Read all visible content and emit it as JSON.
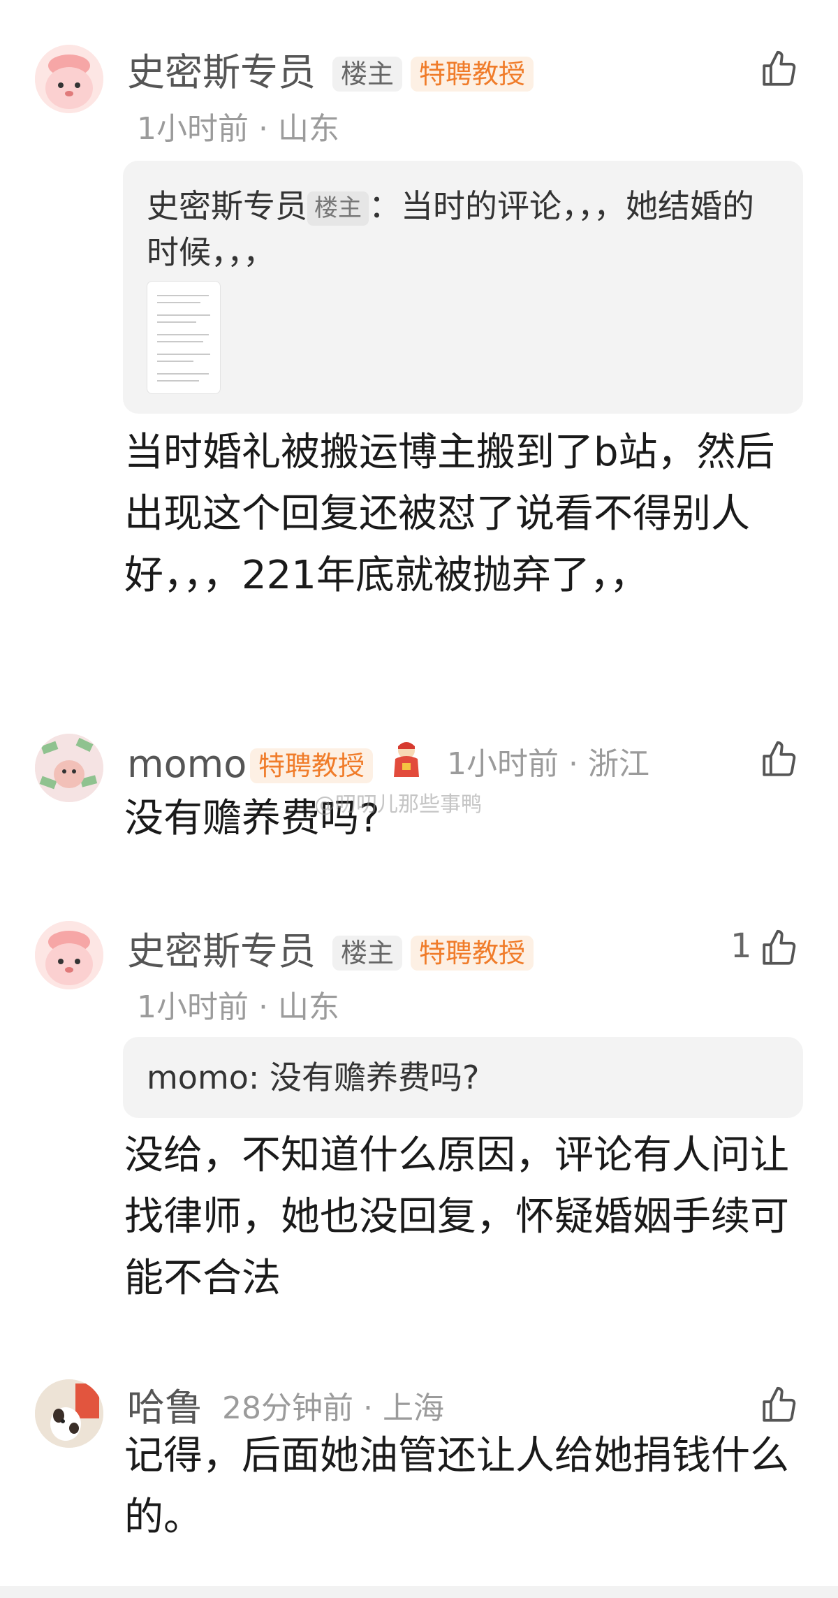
{
  "comments": [
    {
      "name": "史密斯专员",
      "owner_badge": "楼主",
      "title_badge": "特聘教授",
      "time_location": "1小时前 · 山东",
      "quote": {
        "author": "史密斯专员",
        "owner_badge": "楼主",
        "text": "：当时的评论，，，她结婚的时候，，，"
      },
      "body": "当时婚礼被搬运博主搬到了b站，然后出现这个回复还被怼了说看不得别人好，，，221年底就被抛弃了，，"
    },
    {
      "name": "momo",
      "title_badge": "特聘教授",
      "time_location": "1小时前 · 浙江",
      "body": "没有赡养费吗?"
    },
    {
      "name": "史密斯专员",
      "owner_badge": "楼主",
      "title_badge": "特聘教授",
      "time_location": "1小时前 · 山东",
      "like_count": "1",
      "quote": {
        "text": "momo: 没有赡养费吗?"
      },
      "body": "没给，不知道什么原因，评论有人问让找律师，她也没回复，怀疑婚姻手续可能不合法"
    },
    {
      "name": "哈鲁",
      "time_location": "28分钟前 · 上海",
      "body": "记得，后面她油管还让人给她捐钱什么的。"
    }
  ],
  "watermark": "@叨叨儿那些事鸭",
  "icons": {
    "like": "thumbs-up-icon",
    "avatar_pig": "pink-pig-avatar",
    "avatar_money": "money-rain-avatar",
    "avatar_photo": "dog-photo-avatar"
  },
  "colors": {
    "title_badge_text": "#f07c2a",
    "title_badge_bg": "#fdf0e4",
    "meta_text": "#9b9b9b",
    "quote_bg": "#f3f3f3"
  }
}
